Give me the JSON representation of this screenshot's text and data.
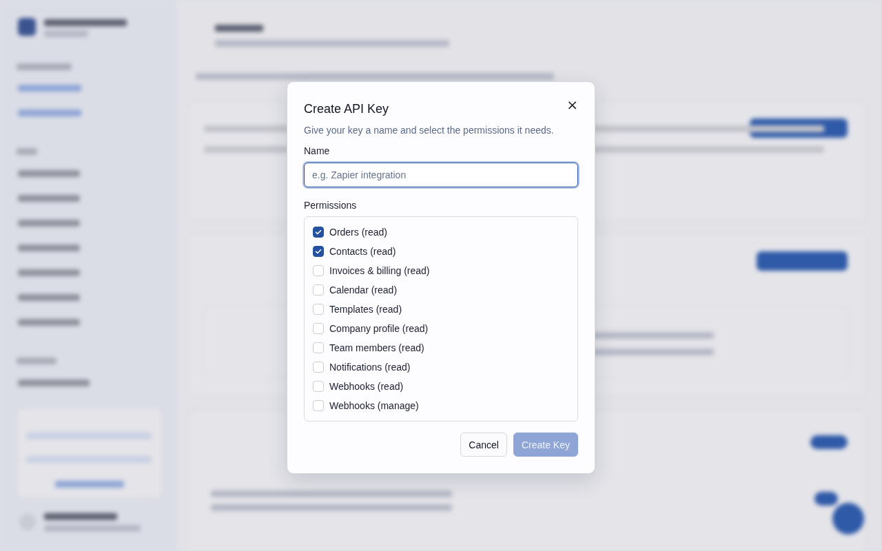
{
  "dialog": {
    "title": "Create API Key",
    "description": "Give your key a name and select the permissions it needs.",
    "close_icon": "×",
    "name_field": {
      "label": "Name",
      "placeholder": "e.g. Zapier integration",
      "focused": true
    },
    "permissions_label": "Permissions",
    "permissions": [
      {
        "label": "Orders (read)",
        "checked": true
      },
      {
        "label": "Contacts (read)",
        "checked": true
      },
      {
        "label": "Invoices & billing (read)",
        "checked": false
      },
      {
        "label": "Calendar (read)",
        "checked": false
      },
      {
        "label": "Templates (read)",
        "checked": false
      },
      {
        "label": "Company profile (read)",
        "checked": false
      },
      {
        "label": "Team members (read)",
        "checked": false
      },
      {
        "label": "Notifications (read)",
        "checked": false
      },
      {
        "label": "Webhooks (read)",
        "checked": false
      },
      {
        "label": "Webhooks (manage)",
        "checked": false
      }
    ],
    "buttons": [
      {
        "label": "Cancel",
        "kind": "secondary",
        "disabled": false
      },
      {
        "label": "Create Key",
        "kind": "primary",
        "disabled": true
      }
    ]
  }
}
